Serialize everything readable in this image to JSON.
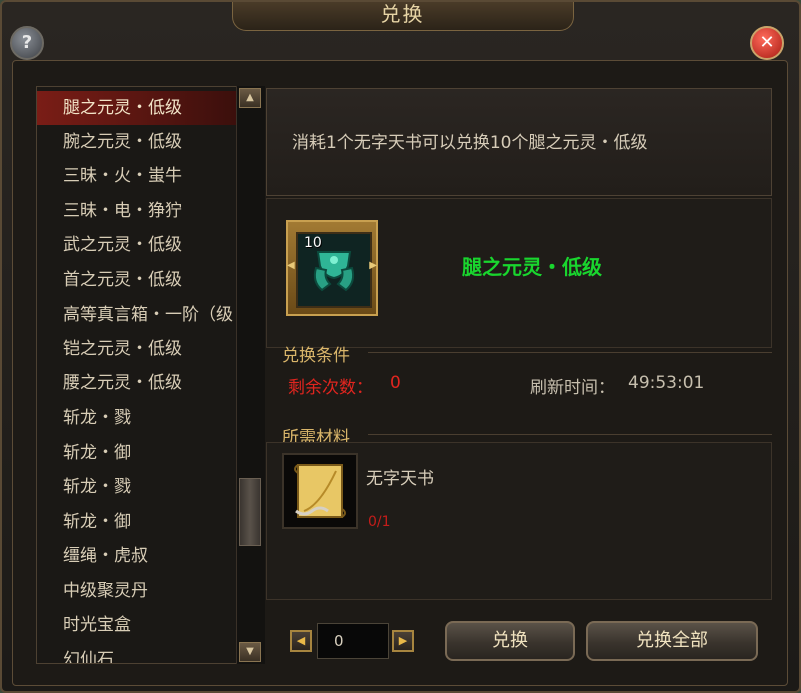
{
  "window": {
    "title": "兑换"
  },
  "list": {
    "items": [
      {
        "label": "腿之元灵・低级",
        "selected": true
      },
      {
        "label": "腕之元灵・低级"
      },
      {
        "label": "三昧・火・蚩牛"
      },
      {
        "label": "三昧・电・狰狞"
      },
      {
        "label": "武之元灵・低级"
      },
      {
        "label": "首之元灵・低级"
      },
      {
        "label": "高等真言箱・一阶（级"
      },
      {
        "label": "铠之元灵・低级"
      },
      {
        "label": "腰之元灵・低级"
      },
      {
        "label": "斩龙・戮"
      },
      {
        "label": "斩龙・御"
      },
      {
        "label": "斩龙・戮"
      },
      {
        "label": "斩龙・御"
      },
      {
        "label": "缰绳・虎叔"
      },
      {
        "label": "中级聚灵丹"
      },
      {
        "label": "时光宝盒"
      },
      {
        "label": "幻仙石"
      }
    ]
  },
  "detail": {
    "description": "消耗1个无字天书可以兑换10个腿之元灵・低级",
    "item_count": "10",
    "item_name": "腿之元灵・低级",
    "conditions_title": "兑换条件",
    "remaining_label": "剩余次数：",
    "remaining_value": "0",
    "refresh_label": "刷新时间：",
    "refresh_value": "49:53:01",
    "materials_title": "所需材料",
    "material_name": "无字天书",
    "material_count": "0/1"
  },
  "controls": {
    "quantity": "0",
    "exchange_label": "兑换",
    "exchange_all_label": "兑换全部"
  },
  "icons": {
    "help": "help-icon",
    "close": "close-icon",
    "item": "jade-leg-armor-icon",
    "material": "scroll-icon"
  },
  "colors": {
    "item_name": "#19d62e",
    "warning": "#e0251f",
    "section_title": "#d9b56a",
    "selected_row": "#7a1d16"
  }
}
